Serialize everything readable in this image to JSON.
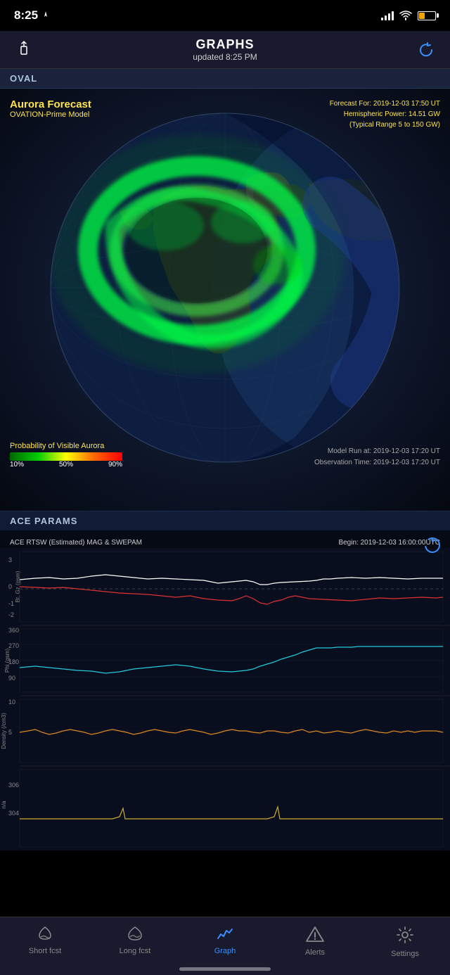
{
  "statusBar": {
    "time": "8:25",
    "hasLocation": true
  },
  "navBar": {
    "title": "GRAPHS",
    "subtitle": "updated  8:25 PM",
    "shareLabel": "share",
    "refreshLabel": "refresh"
  },
  "sections": {
    "oval": {
      "label": "OVAL"
    },
    "aceParams": {
      "label": "ACE PARAMS"
    }
  },
  "aurora": {
    "title": "Aurora Forecast",
    "model": "OVATION-Prime Model",
    "forecastFor": "Forecast For: 2019-12-03 17:50 UT",
    "hemisphericPower": "Hemispheric Power: 14.51 GW",
    "typicalRange": "(Typical Range 5 to 150 GW)",
    "probabilityLabel": "Probability of Visible Aurora",
    "tick10": "10%",
    "tick50": "50%",
    "tick90": "90%",
    "modelRun": "Model Run at: 2019-12-03 17:20 UT",
    "observationTime": "Observation Time: 2019-12-03 17:20 UT"
  },
  "aceGraph": {
    "title": "ACE RTSW (Estimated) MAG & SWEPAM",
    "begin": "Begin: 2019-12-03 16:00:00UTC",
    "yAxisBtGt": "Bt, Gz (gsm)",
    "yAxisPhi": "Phi (gsm)",
    "yAxisDensity": "Density (/cm3)",
    "yAxisSpeed": "n/a",
    "btMax": "3",
    "btMid": "0",
    "btMin": "-2",
    "phiMax": "360",
    "phi270": "270",
    "phi180": "180",
    "phi90": "90",
    "densityMax": "10",
    "density5": "5",
    "speedMax": "306",
    "speedMid": "304"
  },
  "tabs": [
    {
      "id": "short-fcst",
      "label": "Short fcst",
      "active": false
    },
    {
      "id": "long-fcst",
      "label": "Long fcst",
      "active": false
    },
    {
      "id": "graph",
      "label": "Graph",
      "active": true
    },
    {
      "id": "alerts",
      "label": "Alerts",
      "active": false
    },
    {
      "id": "settings",
      "label": "Settings",
      "active": false
    }
  ]
}
